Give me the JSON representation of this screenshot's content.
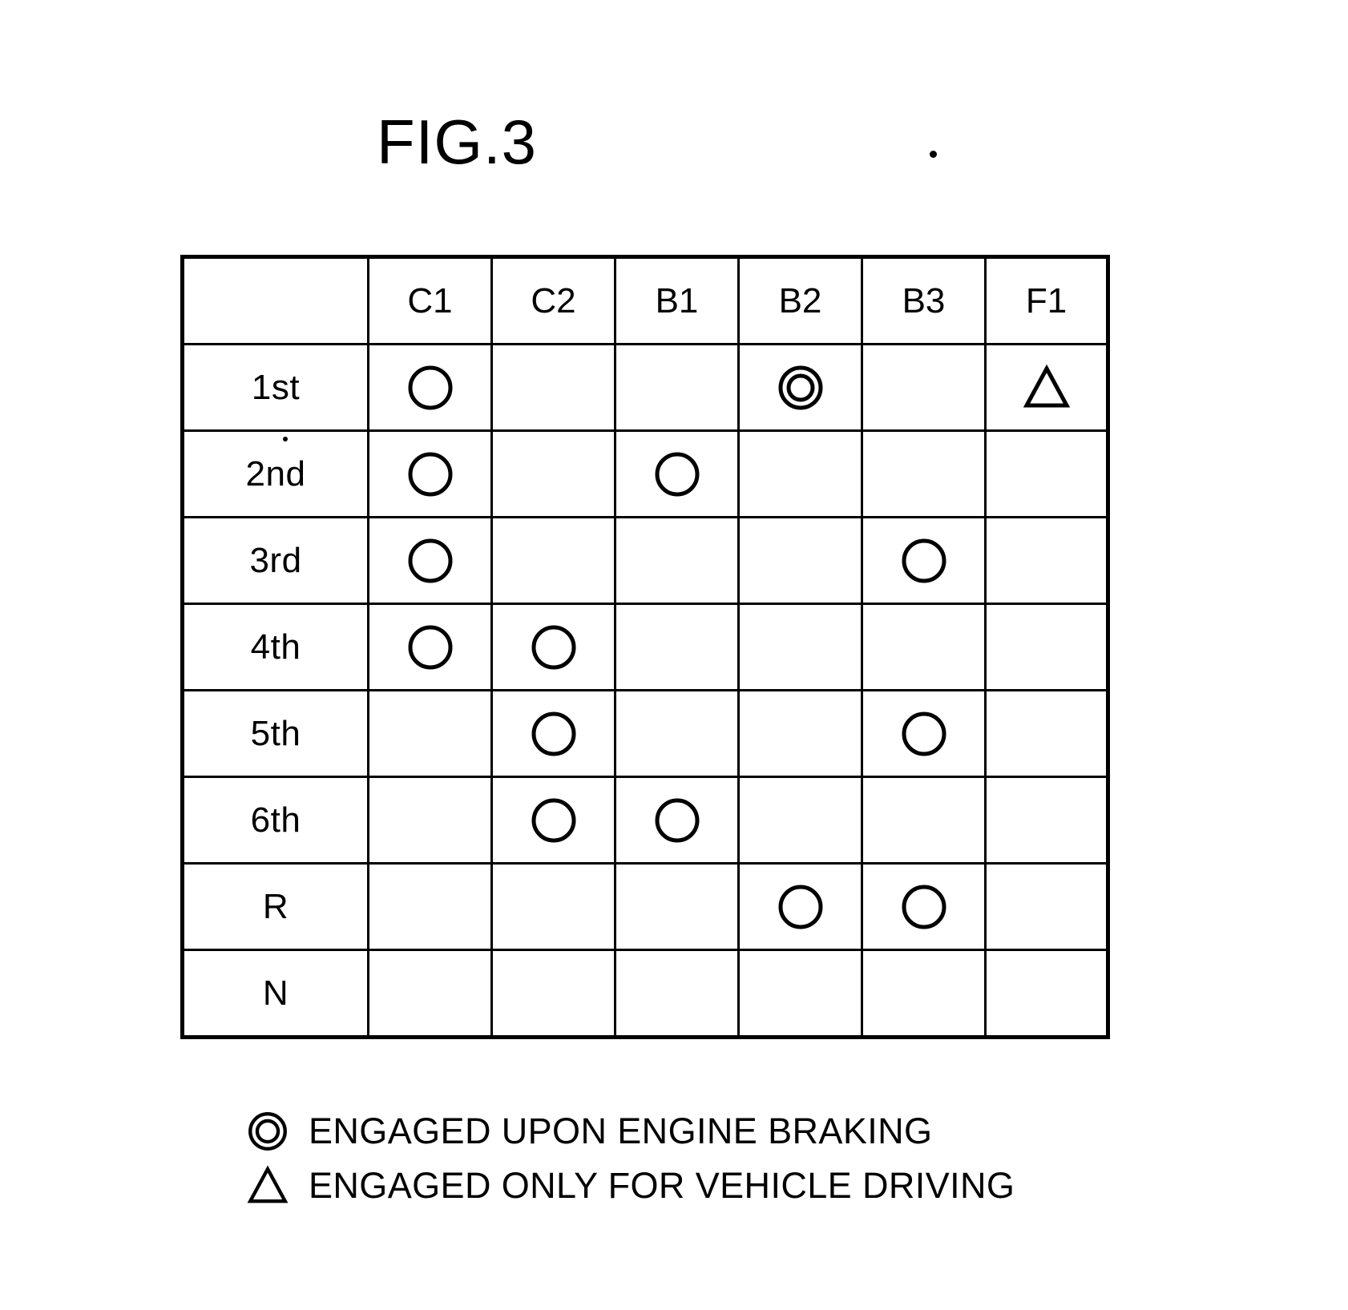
{
  "figure": {
    "title": "FIG.3"
  },
  "table": {
    "corner_label": "",
    "columns": [
      "C1",
      "C2",
      "B1",
      "B2",
      "B3",
      "F1"
    ],
    "rows": [
      {
        "label": "1st",
        "cells": [
          "circle",
          "",
          "",
          "double-circle",
          "",
          "triangle"
        ]
      },
      {
        "label": "2nd",
        "cells": [
          "circle",
          "",
          "circle",
          "",
          "",
          ""
        ]
      },
      {
        "label": "3rd",
        "cells": [
          "circle",
          "",
          "",
          "",
          "circle",
          ""
        ]
      },
      {
        "label": "4th",
        "cells": [
          "circle",
          "circle",
          "",
          "",
          "",
          ""
        ]
      },
      {
        "label": "5th",
        "cells": [
          "",
          "circle",
          "",
          "",
          "circle",
          ""
        ]
      },
      {
        "label": "6th",
        "cells": [
          "",
          "circle",
          "circle",
          "",
          "",
          ""
        ]
      },
      {
        "label": "R",
        "cells": [
          "",
          "",
          "",
          "circle",
          "circle",
          ""
        ]
      },
      {
        "label": "N",
        "cells": [
          "",
          "",
          "",
          "",
          "",
          ""
        ]
      }
    ]
  },
  "legend": [
    {
      "symbol": "double-circle",
      "text": "ENGAGED UPON ENGINE BRAKING"
    },
    {
      "symbol": "triangle",
      "text": "ENGAGED ONLY FOR VEHICLE DRIVING"
    }
  ],
  "colors": {
    "ink": "#000000",
    "paper": "#ffffff"
  }
}
